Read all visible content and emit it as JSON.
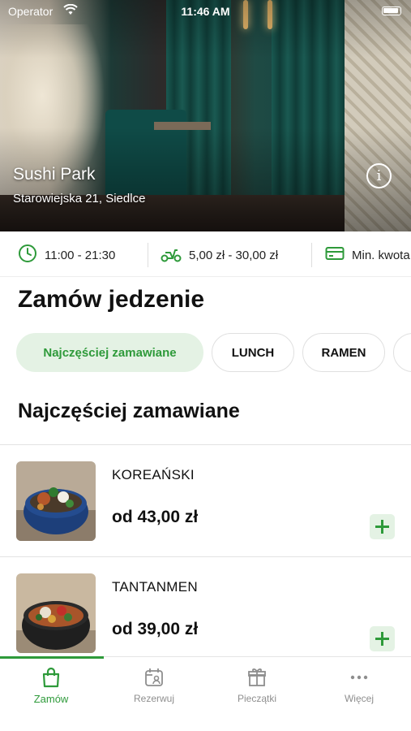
{
  "status_bar": {
    "carrier": "Operator",
    "time": "11:46 AM"
  },
  "restaurant": {
    "name": "Sushi Park",
    "address": "Starowiejska 21, Siedlce"
  },
  "info_strip": {
    "hours": "11:00 - 21:30",
    "delivery_cost": "5,00 zł - 30,00 zł",
    "min_order_label": "Min. kwota"
  },
  "page_title": "Zamów jedzenie",
  "categories": [
    {
      "label": "Najczęściej zamawiane",
      "active": true
    },
    {
      "label": "LUNCH",
      "active": false
    },
    {
      "label": "RAMEN",
      "active": false
    }
  ],
  "current_category_title": "Najczęściej zamawiane",
  "products": [
    {
      "name": "KOREAŃSKI",
      "price": "od 43,00 zł"
    },
    {
      "name": "TANTANMEN",
      "price": "od 39,00 zł"
    }
  ],
  "tabbar": {
    "items": [
      {
        "label": "Zamów",
        "icon": "bag-icon",
        "active": true
      },
      {
        "label": "Rezerwuj",
        "icon": "calendar-person-icon",
        "active": false
      },
      {
        "label": "Pieczątki",
        "icon": "gift-icon",
        "active": false
      },
      {
        "label": "Więcej",
        "icon": "more-dots-icon",
        "active": false
      }
    ]
  },
  "colors": {
    "accent": "#2e9a3a",
    "accent_light": "#e4f2e4",
    "text": "#111111",
    "muted": "#8e8e8e"
  }
}
